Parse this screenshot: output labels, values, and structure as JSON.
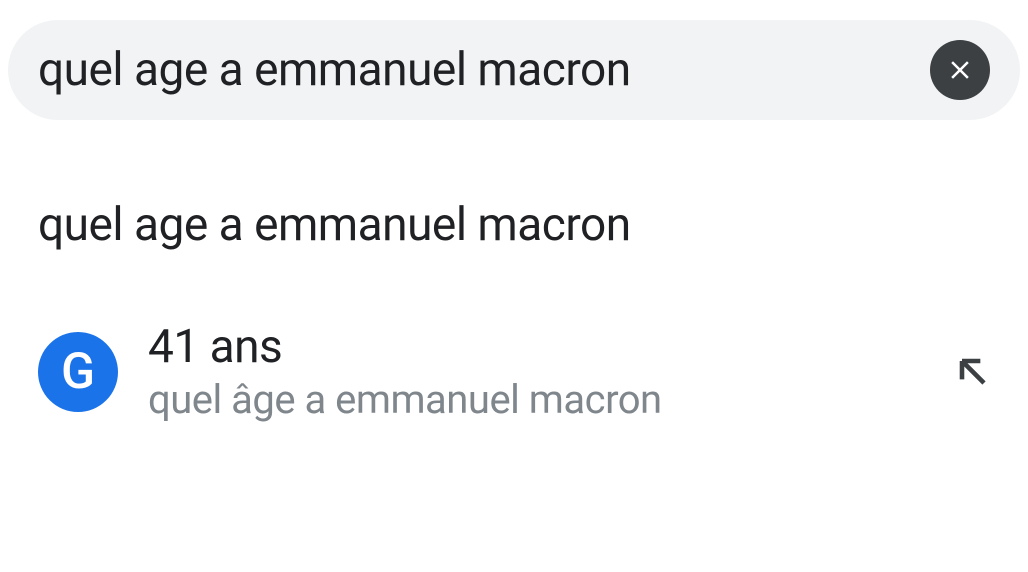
{
  "search": {
    "query": "quel age a emmanuel macron"
  },
  "suggestions": [
    {
      "text": "quel age a emmanuel macron"
    }
  ],
  "answer": {
    "badge_letter": "G",
    "primary": "41 ans",
    "secondary": "quel âge a emmanuel macron"
  }
}
